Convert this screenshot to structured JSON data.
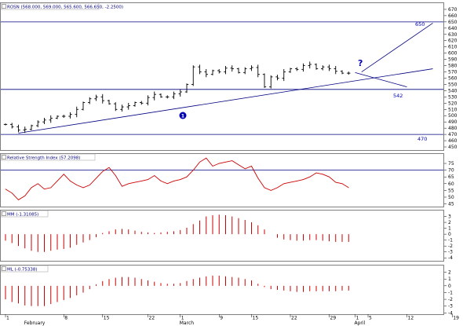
{
  "colors": {
    "price": "#000000",
    "indicator": "#cc0000",
    "guide": "#000080",
    "annotation": "#0000b0",
    "panel_border": "#7f7f7f",
    "grid": "#e0e0e0",
    "tab": "#ffffff"
  },
  "panels": {
    "price": {
      "title": "ROSN (568.000, 569.000, 565.600, 566.650, -2.2500)",
      "ylim": [
        445,
        680
      ],
      "ticks": [
        450,
        460,
        470,
        480,
        490,
        500,
        510,
        520,
        530,
        540,
        550,
        560,
        570,
        580,
        590,
        600,
        610,
        620,
        630,
        640,
        650,
        660,
        670
      ]
    },
    "rsi": {
      "title": "Relative Strength Index (57.2098)",
      "ylim": [
        43,
        82
      ],
      "ticks": [
        45,
        50,
        55,
        60,
        65,
        70,
        75
      ]
    },
    "mm": {
      "title": "MM (-1.31085)",
      "ylim": [
        -4.5,
        4
      ],
      "ticks": [
        -4,
        -3,
        -2,
        -1,
        0,
        1,
        2,
        3
      ]
    },
    "ml": {
      "title": "ML (-0.75338)",
      "ylim": [
        -4.2,
        3
      ],
      "ticks": [
        -4,
        -3,
        -2,
        -1,
        0,
        1,
        2
      ]
    }
  },
  "x_axis": {
    "date_ticks": [
      {
        "label": "1",
        "i": 0
      },
      {
        "label": "February",
        "i": 3
      },
      {
        "label": "8",
        "i": 9
      },
      {
        "label": "15",
        "i": 15
      },
      {
        "label": "22",
        "i": 22
      },
      {
        "label": "1",
        "i": 27
      },
      {
        "label": "March",
        "i": 27
      },
      {
        "label": "9",
        "i": 33
      },
      {
        "label": "15",
        "i": 38
      },
      {
        "label": "22",
        "i": 44
      },
      {
        "label": "29",
        "i": 50
      },
      {
        "label": "1",
        "i": 54
      },
      {
        "label": "April",
        "i": 54
      },
      {
        "label": "5",
        "i": 56
      },
      {
        "label": "12",
        "i": 62
      },
      {
        "label": "19",
        "i": 69
      }
    ]
  },
  "annotations": {
    "level_650": "650",
    "level_542": "542",
    "level_470": "470",
    "question_mark": "?",
    "marker_one": "1"
  },
  "chart_data": [
    {
      "type": "ohlc",
      "title": "ROSN (568.000, 569.000, 565.600, 566.650, -2.2500)",
      "close": [
        486,
        482,
        477,
        478,
        484,
        490,
        493,
        496,
        499,
        499,
        502,
        510,
        521,
        527,
        530,
        524,
        519,
        510,
        514,
        516,
        521,
        520,
        529,
        534,
        530,
        530,
        535,
        538,
        550,
        578,
        570,
        566,
        572,
        570,
        576,
        575,
        569,
        575,
        577,
        566,
        546,
        562,
        560,
        570,
        575,
        574,
        580,
        582,
        575,
        578,
        575,
        571,
        568,
        568
      ],
      "ylim": [
        445,
        680
      ],
      "horizontal_levels": [
        650,
        542,
        470
      ],
      "trend_lines": [
        {
          "from": {
            "i": 2,
            "y": 472
          },
          "to": {
            "i": 66,
            "y": 575
          }
        },
        {
          "from": {
            "i": 55,
            "y": 570
          },
          "to": {
            "i": 66,
            "y": 648
          }
        },
        {
          "from": {
            "i": 54,
            "y": 569
          },
          "to": {
            "i": 62,
            "y": 546
          }
        }
      ]
    },
    {
      "type": "line",
      "title": "Relative Strength Index (57.2098)",
      "values": [
        56,
        53,
        48,
        51,
        57,
        60,
        56,
        57,
        62,
        67,
        62,
        59,
        57,
        59,
        64,
        69,
        72,
        66,
        58,
        60,
        61,
        62,
        63,
        66,
        62,
        60,
        62,
        63,
        65,
        70,
        76,
        79,
        73,
        75,
        76,
        77,
        74,
        71,
        73,
        64,
        57,
        55,
        57,
        60,
        61,
        62,
        63,
        65,
        68,
        67,
        65,
        61,
        60,
        57
      ],
      "reference_line": 70,
      "ylim": [
        43,
        82
      ]
    },
    {
      "type": "bar",
      "title": "MM (-1.31085)",
      "values": [
        -1.1,
        -1.5,
        -2.0,
        -2.4,
        -2.8,
        -3.0,
        -3.0,
        -2.8,
        -2.6,
        -2.5,
        -2.3,
        -1.8,
        -1.4,
        -1.0,
        -0.5,
        0.2,
        0.5,
        0.8,
        0.9,
        0.8,
        0.6,
        0.4,
        0.3,
        0.2,
        0.3,
        0.4,
        0.5,
        0.7,
        1.1,
        1.7,
        2.3,
        3.0,
        3.2,
        3.3,
        3.2,
        3.0,
        2.7,
        2.4,
        2.0,
        1.5,
        0.8,
        0.0,
        -0.6,
        -0.9,
        -1.0,
        -1.1,
        -1.1,
        -1.0,
        -1.0,
        -1.1,
        -1.2,
        -1.3,
        -1.3,
        -1.3
      ],
      "ylim": [
        -4.5,
        4
      ]
    },
    {
      "type": "bar",
      "title": "ML (-0.75338)",
      "values": [
        -2.0,
        -2.4,
        -2.6,
        -2.9,
        -3.0,
        -3.0,
        -3.0,
        -2.7,
        -2.4,
        -2.1,
        -1.8,
        -1.4,
        -1.0,
        -0.5,
        0.2,
        0.7,
        1.0,
        1.2,
        1.3,
        1.3,
        1.2,
        1.0,
        0.8,
        0.6,
        0.4,
        0.3,
        0.3,
        0.4,
        0.7,
        1.0,
        1.2,
        1.4,
        1.5,
        1.5,
        1.4,
        1.3,
        1.2,
        1.0,
        0.8,
        0.3,
        -0.2,
        -0.5,
        -0.6,
        -0.7,
        -0.8,
        -0.9,
        -0.9,
        -0.8,
        -0.8,
        -0.8,
        -0.8,
        -0.8,
        -0.7,
        -0.7
      ],
      "ylim": [
        -4.2,
        3
      ]
    }
  ]
}
